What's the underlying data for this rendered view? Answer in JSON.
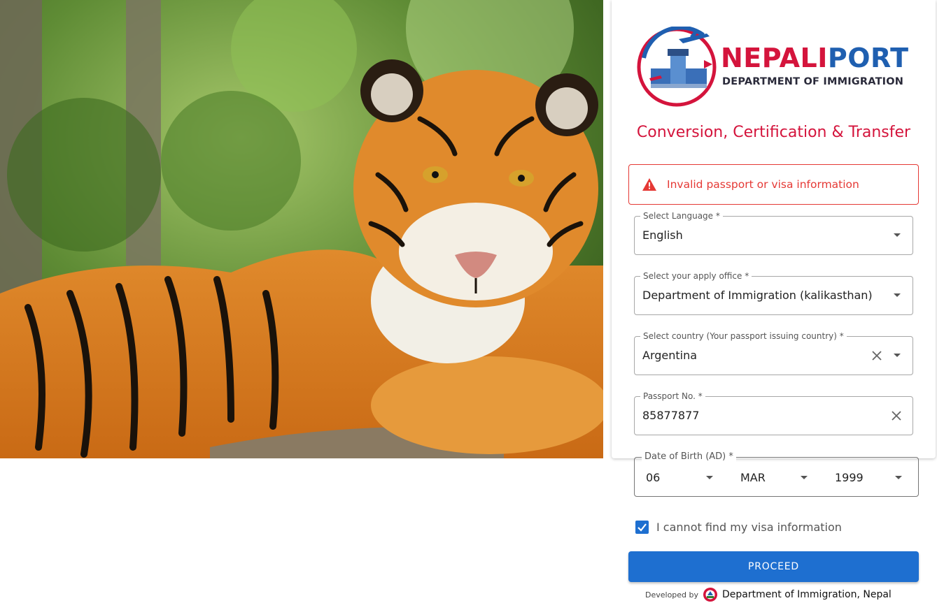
{
  "hero": {
    "image": "bengal-tiger-photo"
  },
  "logo": {
    "brand_part1": "NEPALI",
    "brand_part2": "PORT",
    "subtitle": "DEPARTMENT OF IMMIGRATION"
  },
  "section_title": "Conversion, Certification & Transfer",
  "alert": {
    "icon": "warning-icon",
    "message": "Invalid passport or visa information"
  },
  "form": {
    "language": {
      "label": "Select Language *",
      "value": "English"
    },
    "office": {
      "label": "Select your apply office *",
      "value": "Department of Immigration (kalikasthan)"
    },
    "country": {
      "label": "Select country (Your passport issuing country) *",
      "value": "Argentina"
    },
    "passport": {
      "label": "Passport No. *",
      "value": "85877877"
    },
    "dob": {
      "label": "Date of Birth (AD) *",
      "day": "06",
      "month": "MAR",
      "year": "1999"
    },
    "visa_checkbox": {
      "label": "I cannot find my visa information",
      "checked": true
    },
    "proceed_label": "PROCEED"
  },
  "footer": {
    "developed_by": "Developed by",
    "org": "Department of Immigration, Nepal"
  },
  "colors": {
    "brand_red": "#d4143c",
    "brand_blue": "#1f5fb0",
    "primary": "#1e6fd0",
    "error": "#e53935"
  }
}
